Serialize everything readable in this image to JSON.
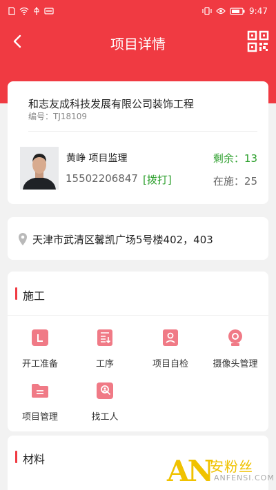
{
  "status_bar": {
    "time": "9:47"
  },
  "nav": {
    "title": "项目详情"
  },
  "project": {
    "name": "和志友成科技发展有限公司装饰工程",
    "code_label": "编号：",
    "code": "TJ18109",
    "person_line": "黄峥 项目监理",
    "phone": "15502206847",
    "dial_label": "[拨打]",
    "remain_label": "剩余：",
    "remain_value": "13",
    "inprogress_label": "在施：",
    "inprogress_value": "25"
  },
  "address": {
    "text": "天津市武清区馨凯广场5号楼402，403"
  },
  "construction": {
    "title": "施工",
    "items": [
      {
        "label": "开工准备",
        "icon": "calendar-icon"
      },
      {
        "label": "工序",
        "icon": "process-doc-icon"
      },
      {
        "label": "项目自检",
        "icon": "self-check-icon"
      },
      {
        "label": "摄像头管理",
        "icon": "camera-icon"
      },
      {
        "label": "项目管理",
        "icon": "folder-icon"
      },
      {
        "label": "找工人",
        "icon": "find-worker-icon"
      }
    ]
  },
  "materials": {
    "title": "材料"
  },
  "watermark": {
    "brand": "AN",
    "cn": "安粉丝",
    "en": "ANFENSI.COM"
  },
  "colors": {
    "primary": "#f03a42",
    "icon_bg": "#f07a86",
    "green": "#2ea02e"
  }
}
